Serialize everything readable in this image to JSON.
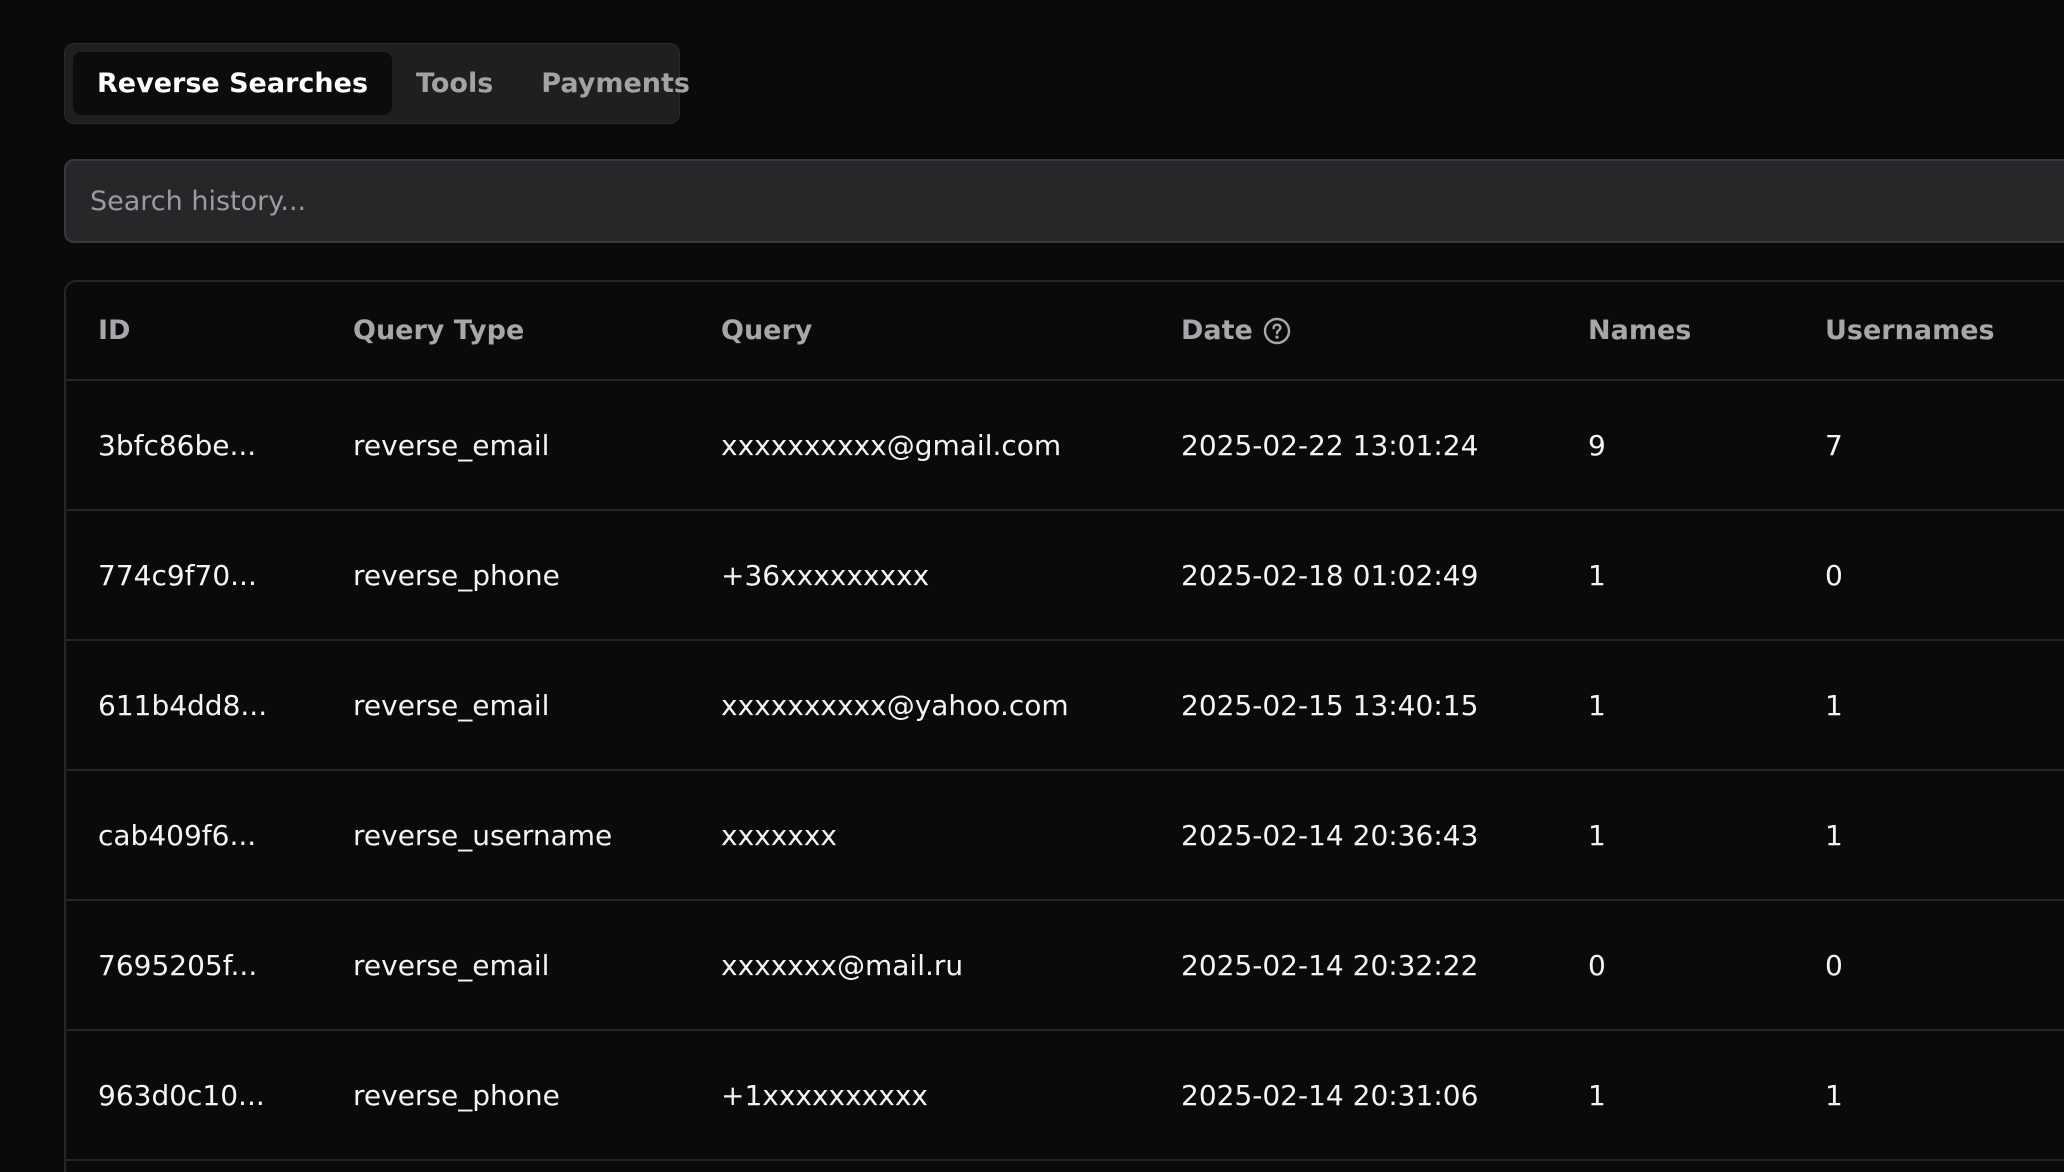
{
  "tabs": [
    {
      "label": "Reverse Searches",
      "active": true
    },
    {
      "label": "Tools",
      "active": false
    },
    {
      "label": "Payments",
      "active": false
    }
  ],
  "search": {
    "placeholder": "Search history...",
    "value": ""
  },
  "table": {
    "columns": {
      "id": "ID",
      "query_type": "Query Type",
      "query": "Query",
      "date": "Date",
      "names": "Names",
      "usernames": "Usernames"
    },
    "date_help_icon": "question-circle-icon",
    "rows": [
      {
        "id": "3bfc86be...",
        "query_type": "reverse_email",
        "query": "xxxxxxxxxx@gmail.com",
        "date": "2025-02-22 13:01:24",
        "names": "9",
        "usernames": "7"
      },
      {
        "id": "774c9f70...",
        "query_type": "reverse_phone",
        "query": "+36xxxxxxxxx",
        "date": "2025-02-18 01:02:49",
        "names": "1",
        "usernames": "0"
      },
      {
        "id": "611b4dd8...",
        "query_type": "reverse_email",
        "query": "xxxxxxxxxx@yahoo.com",
        "date": "2025-02-15 13:40:15",
        "names": "1",
        "usernames": "1"
      },
      {
        "id": "cab409f6...",
        "query_type": "reverse_username",
        "query": "xxxxxxx",
        "date": "2025-02-14 20:36:43",
        "names": "1",
        "usernames": "1"
      },
      {
        "id": "7695205f...",
        "query_type": "reverse_email",
        "query": "xxxxxxx@mail.ru",
        "date": "2025-02-14 20:32:22",
        "names": "0",
        "usernames": "0"
      },
      {
        "id": "963d0c10...",
        "query_type": "reverse_phone",
        "query": "+1xxxxxxxxxx",
        "date": "2025-02-14 20:31:06",
        "names": "1",
        "usernames": "1"
      }
    ]
  },
  "colors": {
    "background": "#0a0a0a",
    "surface": "#27272a",
    "border": "#26262a",
    "text": "#f4f4f4",
    "muted": "#a7a7ab"
  }
}
